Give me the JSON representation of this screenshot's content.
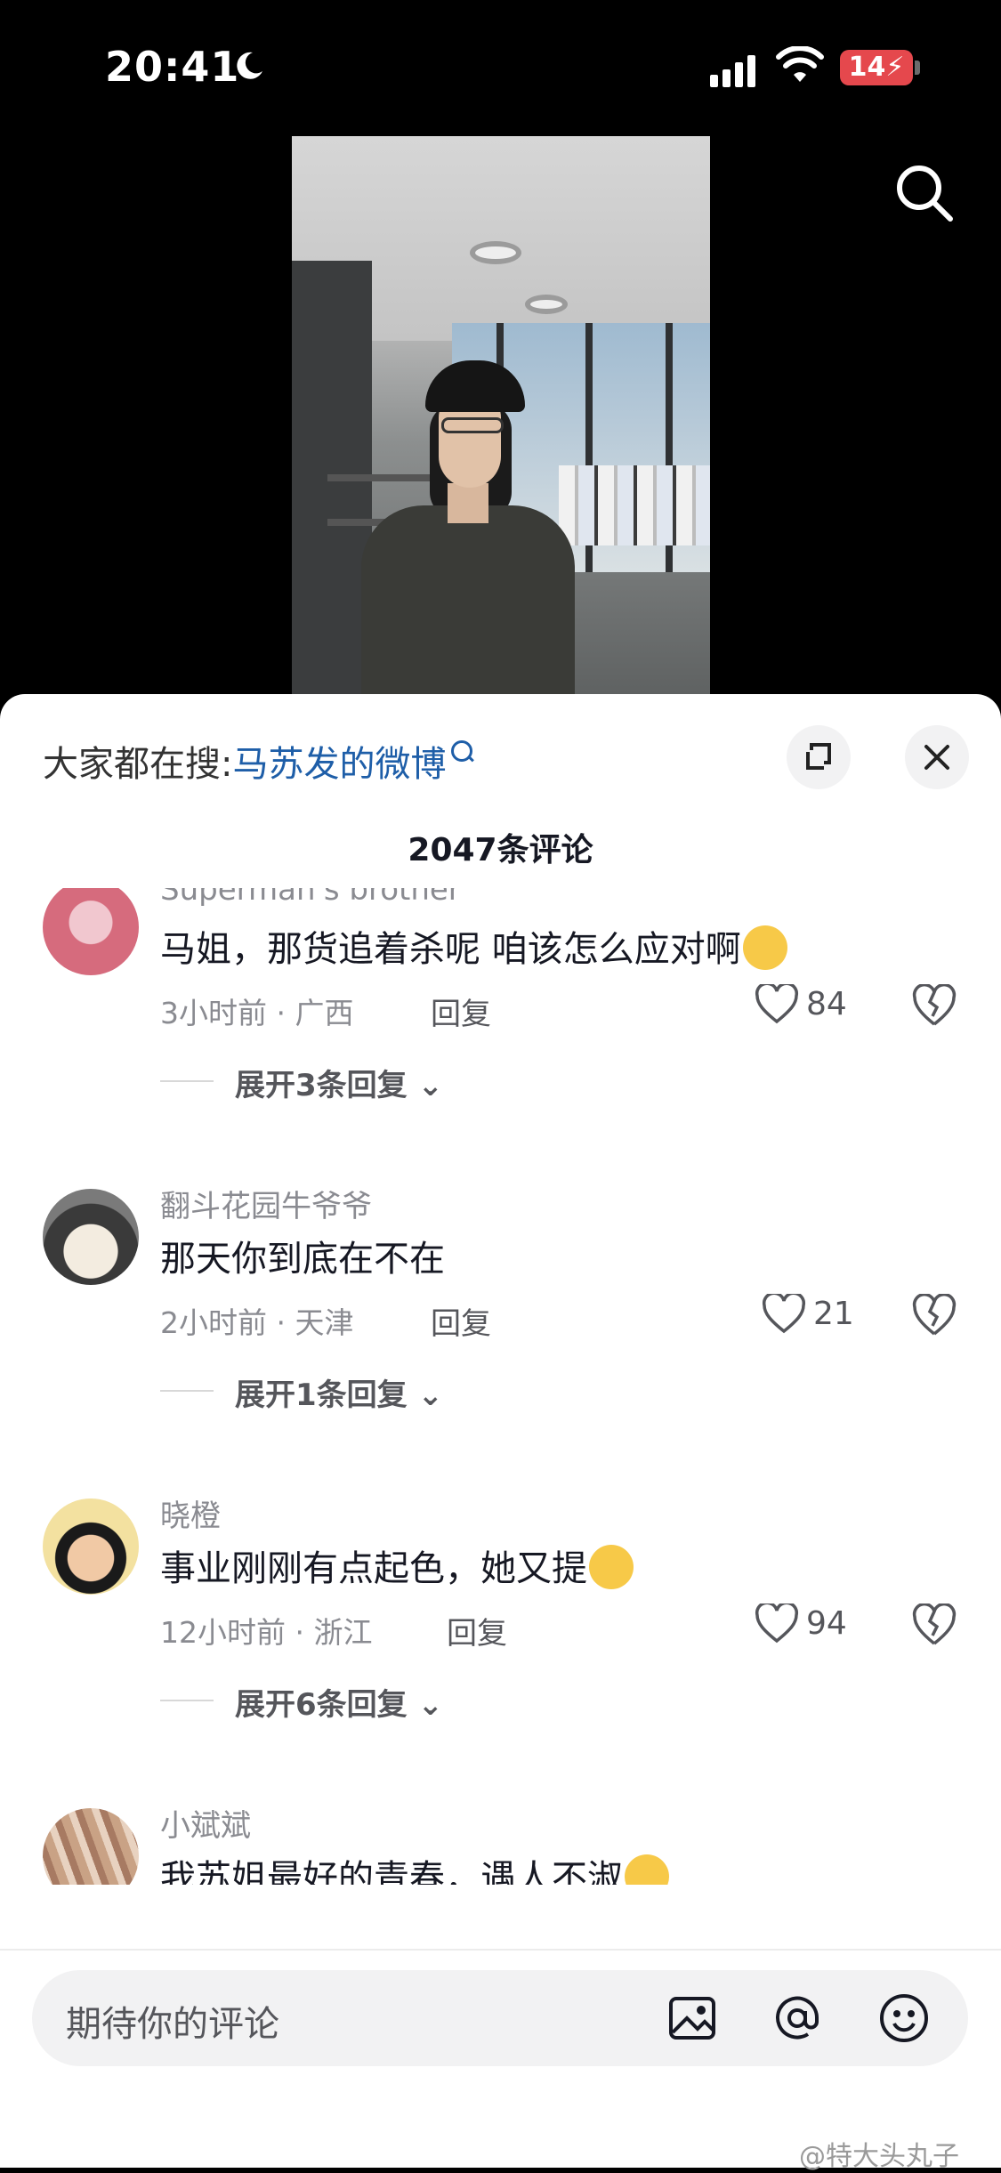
{
  "status_bar": {
    "time": "20:41",
    "battery": "14"
  },
  "hot_search": {
    "prefix": "大家都在搜:",
    "term": "马苏发的微博"
  },
  "comments_header": {
    "count_label": "2047条评论"
  },
  "comments": [
    {
      "username": "Superman's brother",
      "text": "马姐，那货追着杀呢 咱该怎么应对啊",
      "emoji": "pleading-face-emoji",
      "meta": "3小时前 · 广西",
      "reply": "回复",
      "likes": "84",
      "expand": "展开3条回复"
    },
    {
      "username": "翻斗花园牛爷爷",
      "text": "那天你到底在不在",
      "meta": "2小时前 · 天津",
      "reply": "回复",
      "likes": "21",
      "expand": "展开1条回复"
    },
    {
      "username": "晓橙",
      "text": "事业刚刚有点起色，她又提",
      "emoji": "crying-laughing-emoji",
      "meta": "12小时前 · 浙江",
      "reply": "回复",
      "likes": "94",
      "expand": "展开6条回复"
    },
    {
      "username": "小斌斌",
      "text": "我苏姐最好的青春，遇人不淑",
      "emoji": "loudly-crying-emoji"
    }
  ],
  "input": {
    "placeholder": "期待你的评论"
  },
  "watermark": "@特大头丸子",
  "colors": {
    "accent_link": "#1e5ea8",
    "battery_red": "#e5484d"
  }
}
